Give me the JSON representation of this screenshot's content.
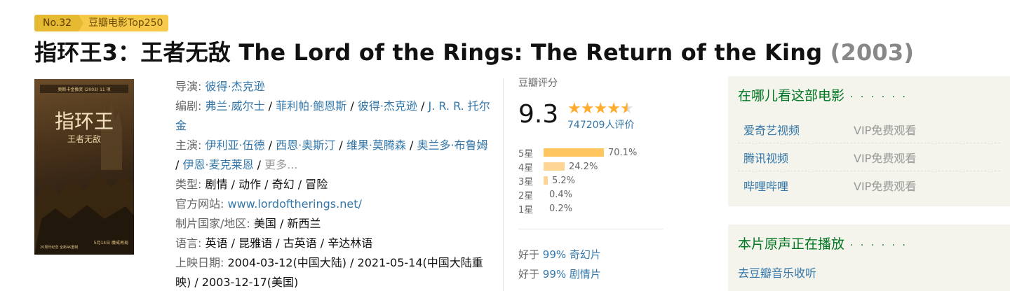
{
  "ranking": {
    "number": "No.32",
    "list_name": "豆瓣电影Top250"
  },
  "title": {
    "main": "指环王3：王者无敌 The Lord of the Rings: The Return of the King",
    "year": "(2003)"
  },
  "poster": {
    "title_cn": "指环王",
    "subtitle_cn": "王者无敌"
  },
  "info": {
    "director_label": "导演:",
    "directors": [
      "彼得·杰克逊"
    ],
    "writer_label": "编剧:",
    "writers": [
      "弗兰·威尔士",
      "菲利帕·鲍恩斯",
      "彼得·杰克逊",
      "J. R. R. 托尔金"
    ],
    "cast_label": "主演:",
    "cast": [
      "伊利亚·伍德",
      "西恩·奥斯汀",
      "维果·莫腾森",
      "奥兰多·布鲁姆",
      "伊恩·麦克莱恩"
    ],
    "more": "更多...",
    "genre_label": "类型:",
    "genre": "剧情 / 动作 / 奇幻 / 冒险",
    "site_label": "官方网站:",
    "site": "www.lordoftherings.net/",
    "country_label": "制片国家/地区:",
    "country": "美国 / 新西兰",
    "language_label": "语言:",
    "language": "英语 / 昆雅语 / 古英语 / 辛达林语",
    "release_label": "上映日期:",
    "release": "2004-03-12(中国大陆) / 2021-05-14(中国大陆重映) / 2003-12-17(美国)"
  },
  "rating": {
    "label": "豆瓣评分",
    "score": "9.3",
    "stars": 4.5,
    "votes": "747209人评价",
    "bars": [
      {
        "star": "5星",
        "percent": "70.1%",
        "value": 70.1
      },
      {
        "star": "4星",
        "percent": "24.2%",
        "value": 24.2
      },
      {
        "star": "3星",
        "percent": "5.2%",
        "value": 5.2
      },
      {
        "star": "2星",
        "percent": "0.4%",
        "value": 0.4
      },
      {
        "star": "1星",
        "percent": "0.2%",
        "value": 0.2
      }
    ],
    "better_than": [
      {
        "prefix": "好于",
        "pct": "99%",
        "genre": "奇幻片"
      },
      {
        "prefix": "好于",
        "pct": "99%",
        "genre": "剧情片"
      }
    ]
  },
  "watch": {
    "heading": "在哪儿看这部电影",
    "dots": "· · · · · ·",
    "sources": [
      {
        "name": "爱奇艺视频",
        "price": "VIP免费观看"
      },
      {
        "name": "腾讯视频",
        "price": "VIP免费观看"
      },
      {
        "name": "哔哩哔哩",
        "price": "VIP免费观看"
      }
    ]
  },
  "music": {
    "heading": "本片原声正在播放",
    "dots": "· · · · · ·",
    "link": "去豆瓣音乐收听"
  },
  "colors": {
    "link": "#3377aa",
    "green": "#007722",
    "star": "#ffac2d",
    "badge": "#e6b932"
  }
}
